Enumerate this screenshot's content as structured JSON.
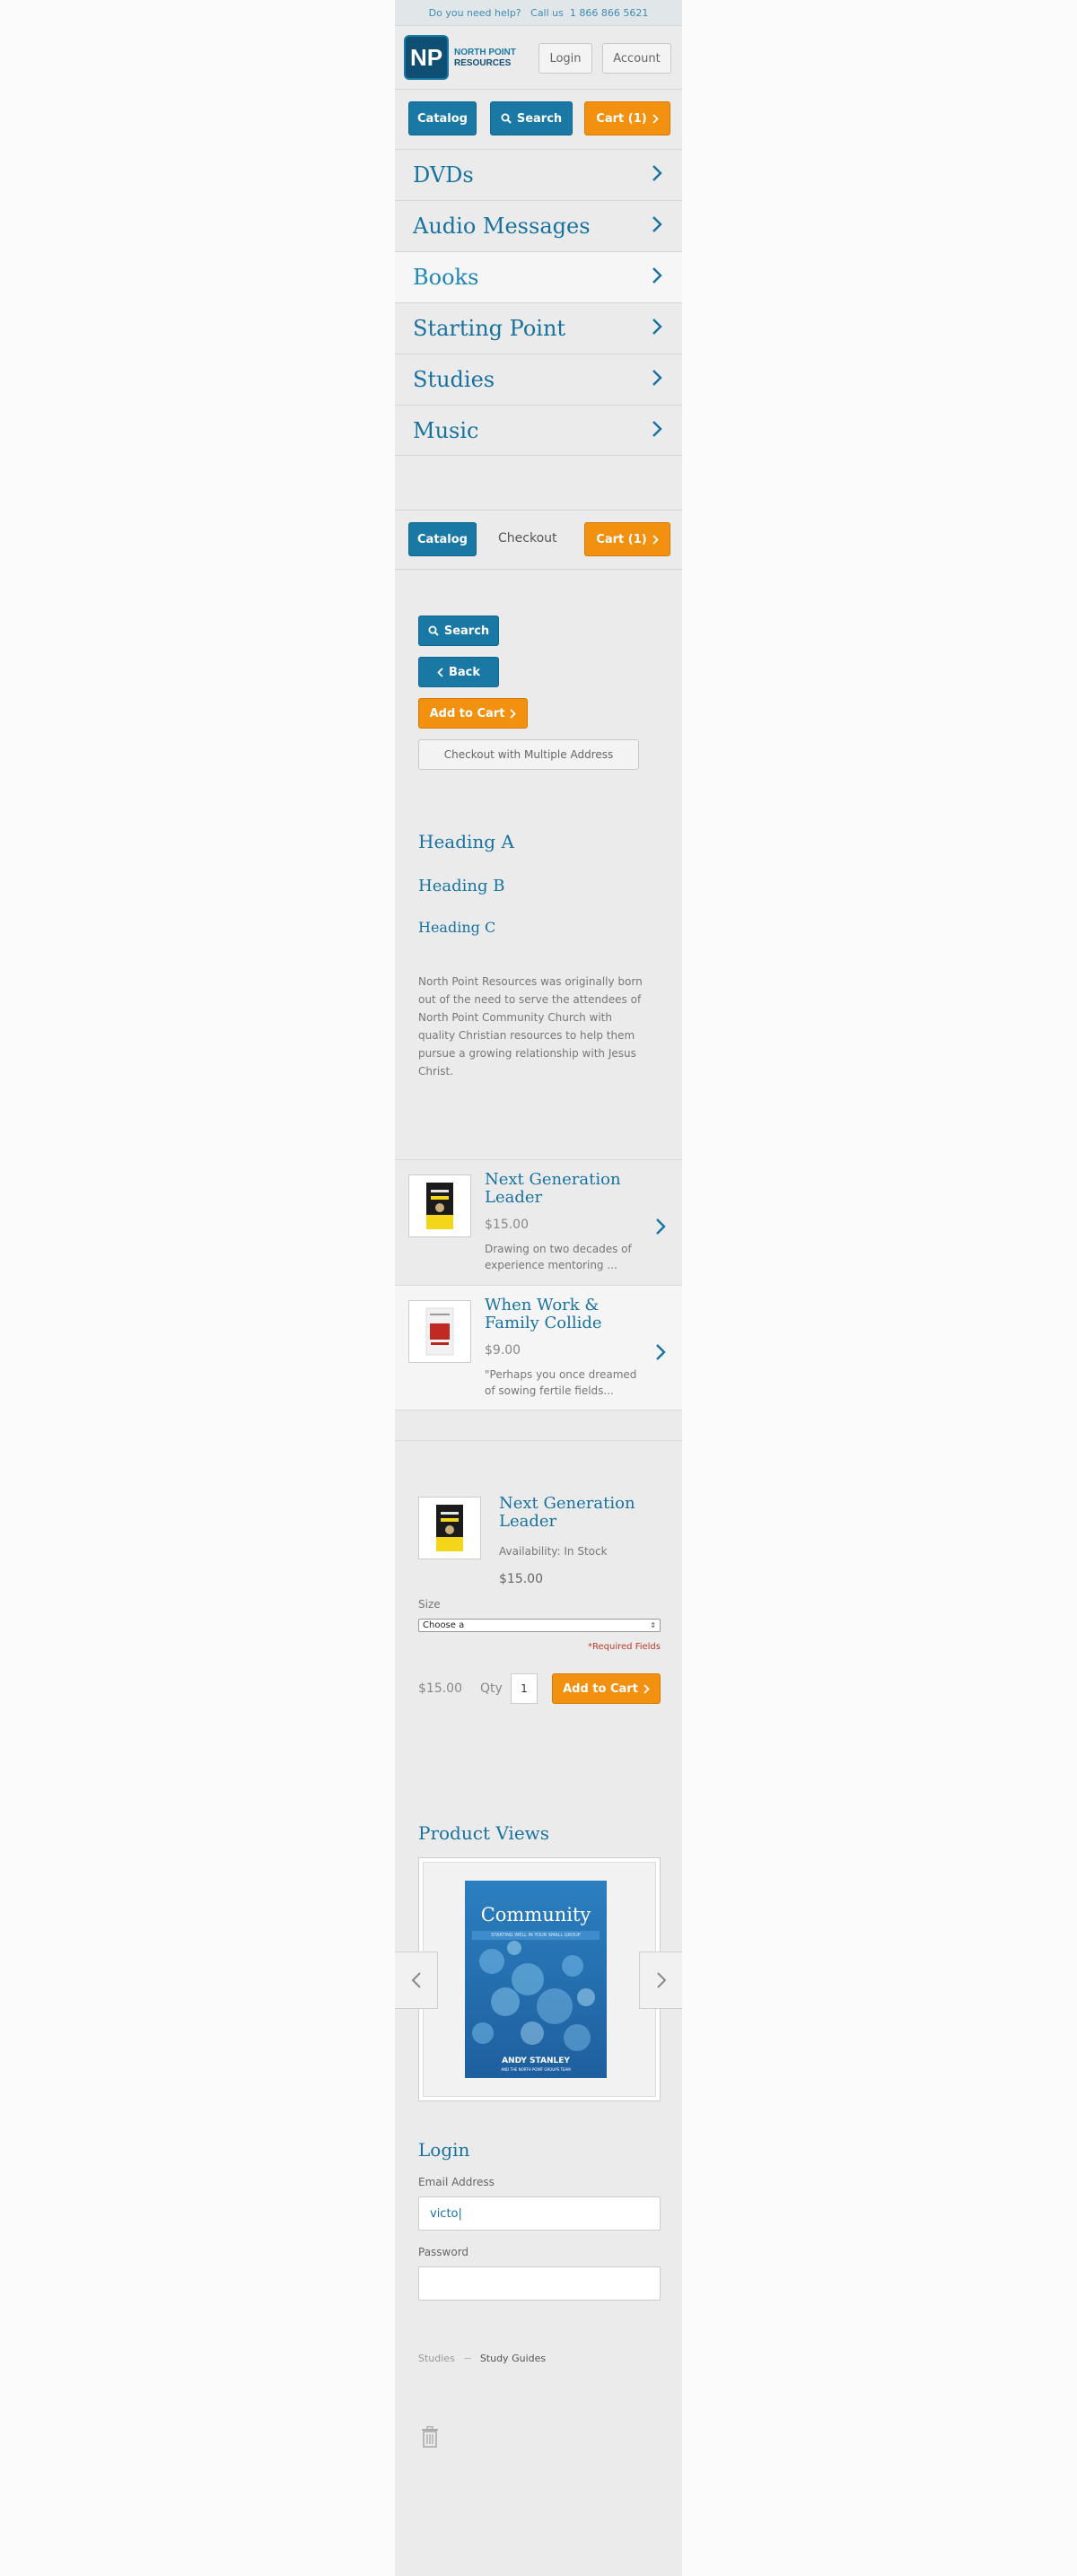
{
  "colors": {
    "blue": "#1a78a5",
    "orange": "#f2900f",
    "panel": "#ebebeb",
    "link": "#1872a0",
    "required": "#c0392b"
  },
  "topbar": {
    "text": "Do you need help?   Call us  1 866 866 5621"
  },
  "header": {
    "logo_mark": "NP",
    "logo_line1": "NORTH POINT",
    "logo_line2": "RESOURCES",
    "login_label": "Login",
    "account_label": "Account"
  },
  "toolbar1": {
    "catalog_label": "Catalog",
    "search_label": "Search",
    "cart_label": "Cart (1)"
  },
  "nav": {
    "items": [
      "DVDs",
      "Audio Messages",
      "Books",
      "Starting Point",
      "Studies",
      "Music"
    ]
  },
  "toolbar2": {
    "catalog_label": "Catalog",
    "checkout_label": "Checkout",
    "cart_label": "Cart (1)"
  },
  "buttons": {
    "search_label": "Search",
    "back_label": "Back",
    "add_to_cart_label": "Add to Cart",
    "multi_address_label": "Checkout with Multiple Address"
  },
  "headings": {
    "a": "Heading A",
    "b": "Heading B",
    "c": "Heading C"
  },
  "about": {
    "text": "North Point Resources was originally born out of the need to serve the attendees of North Point Community Church with quality Christian resources to help them pursue a growing relationship with Jesus Christ."
  },
  "products": [
    {
      "title": "Next Generation Leader",
      "price": "$15.00",
      "desc": "Drawing on two decades of experience mentoring ..."
    },
    {
      "title": "When Work & Family Collide",
      "price": "$9.00",
      "desc": "\"Perhaps you once dreamed of sowing fertile fields..."
    }
  ],
  "detail": {
    "title": "Next Generation Leader",
    "availability": "Availability: In Stock",
    "price": "$15.00",
    "size_label": "Size",
    "size_value": "Choose a",
    "required": "*Required Fields",
    "total": "$15.00",
    "qty_label": "Qty",
    "qty_value": "1",
    "add_label": "Add to Cart"
  },
  "views": {
    "title": "Product Views",
    "cover_title": "Community",
    "cover_subtitle": "STARTING WELL IN YOUR SMALL GROUP",
    "cover_author": "ANDY STANLEY",
    "cover_author2": "AND THE NORTH POINT GROUPS TEAM"
  },
  "login": {
    "title": "Login",
    "email_label": "Email Address",
    "email_value": "victo|",
    "password_label": "Password"
  },
  "breadcrumb": {
    "item1": "Studies",
    "item2": "Study Guides"
  },
  "icons": {
    "trash": "trash-icon",
    "search": "search-icon",
    "chevron": "chevron-right-icon"
  }
}
